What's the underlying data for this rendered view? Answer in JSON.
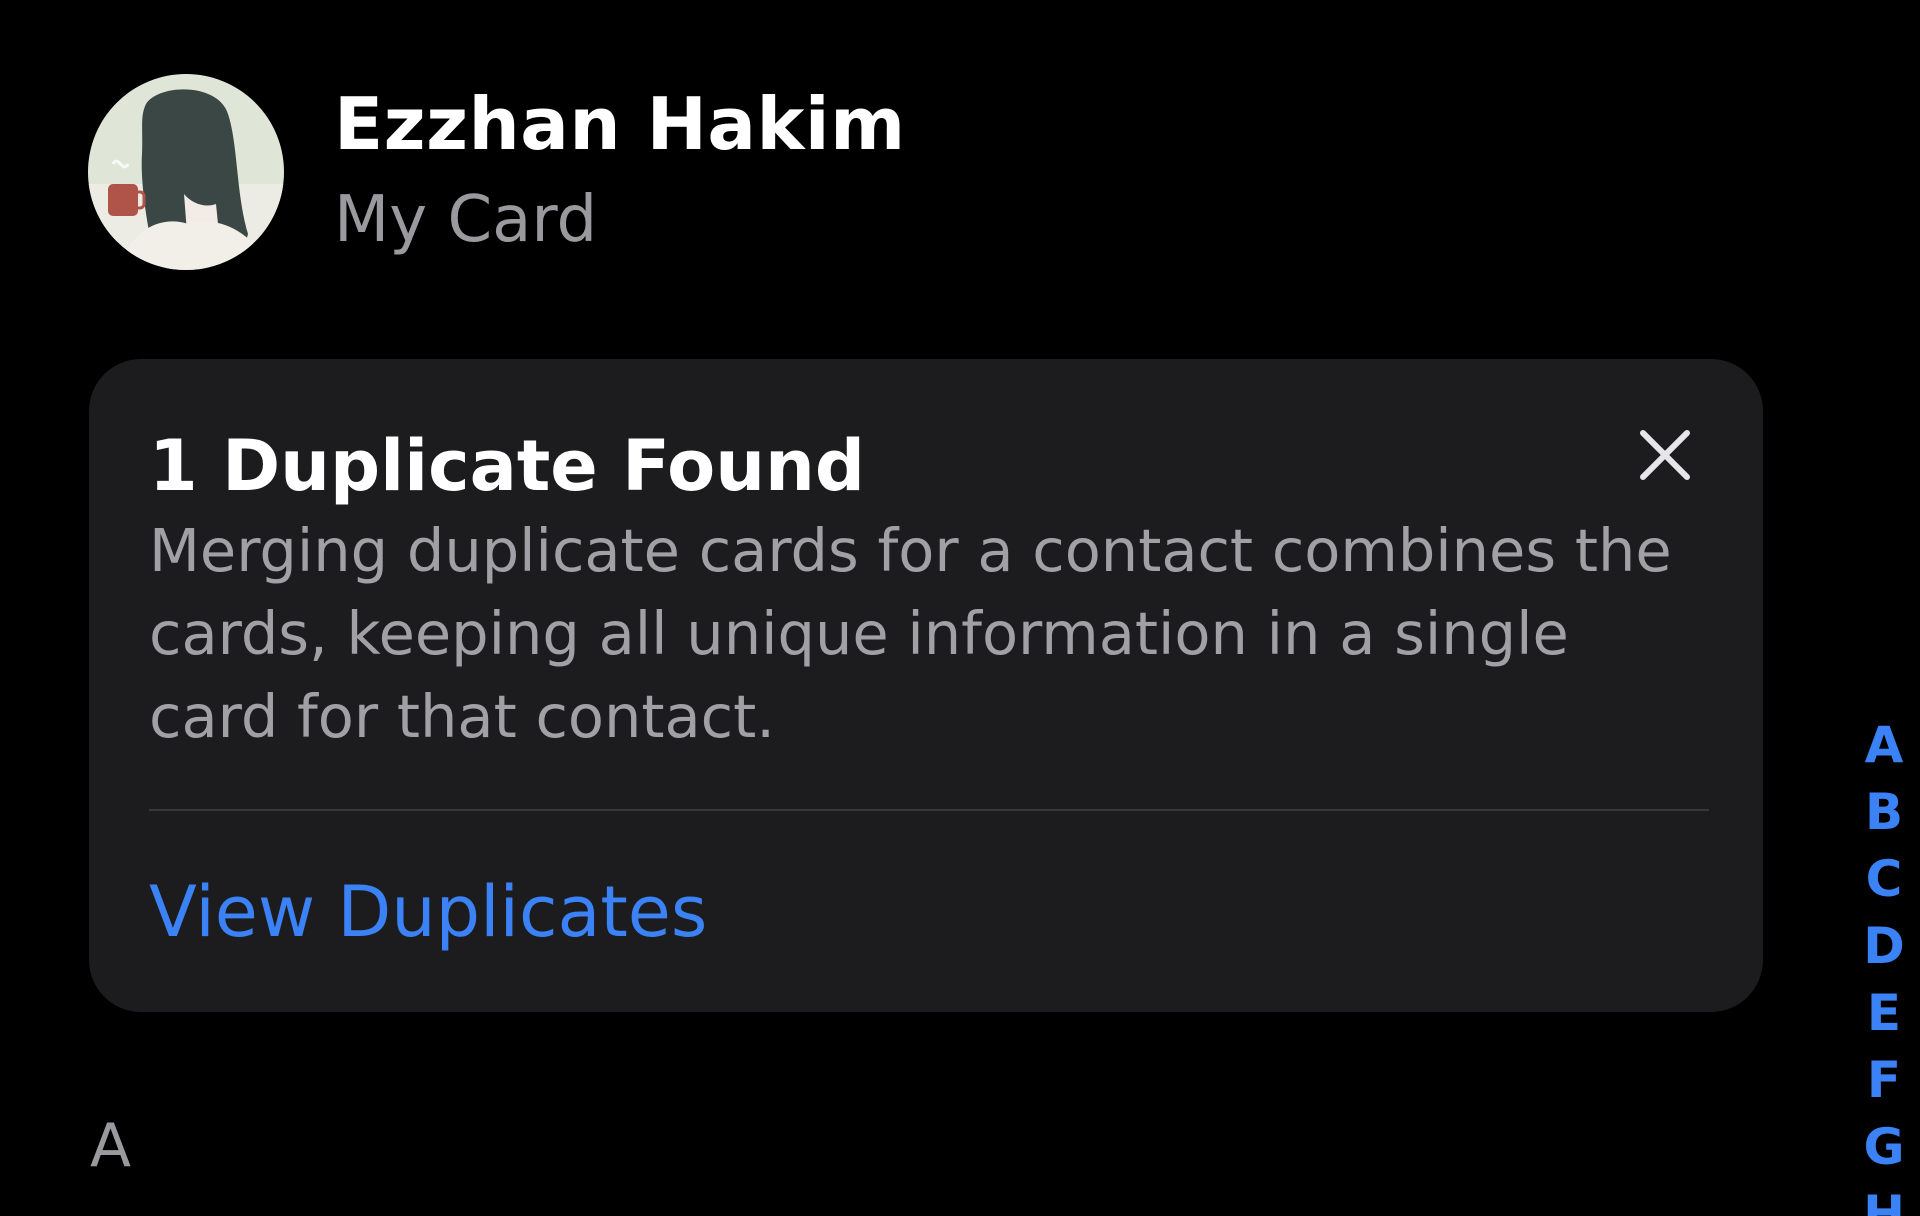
{
  "my_card": {
    "name": "Ezzhan Hakim",
    "subtitle": "My Card",
    "avatar_icon": "avatar-illustration"
  },
  "duplicate_notice": {
    "title": "1 Duplicate Found",
    "description": "Merging duplicate cards for a contact combines the cards, keeping all unique information in a single card for that contact.",
    "action_label": "View Duplicates",
    "close_icon": "close-icon"
  },
  "section_header": "A",
  "index_bar": {
    "letters": [
      "A",
      "B",
      "C",
      "D",
      "E",
      "F",
      "G",
      "H"
    ]
  },
  "colors": {
    "background": "#000000",
    "card": "#1c1c1e",
    "accent": "#3b82f6",
    "secondary_text": "#9a9a9e"
  }
}
